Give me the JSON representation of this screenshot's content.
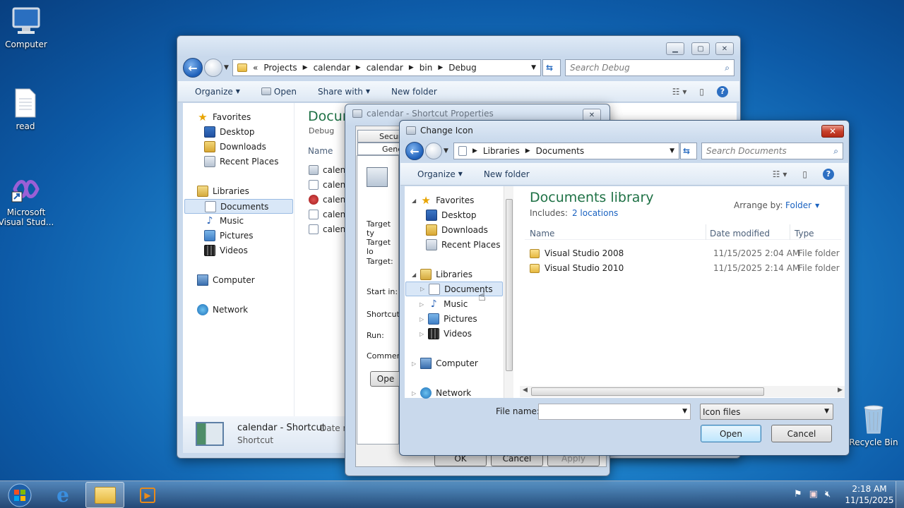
{
  "desktop": {
    "icons": [
      {
        "label": "Computer",
        "icon": "computer-icon"
      },
      {
        "label": "read",
        "icon": "text-file-icon"
      },
      {
        "label": "Microsoft Visual Stud...",
        "icon": "visual-studio-icon"
      },
      {
        "label": "Recycle Bin",
        "icon": "recycle-bin-icon"
      }
    ]
  },
  "explorer": {
    "breadcrumb_prefix": "«",
    "breadcrumb": [
      "Projects",
      "calendar",
      "calendar",
      "bin",
      "Debug"
    ],
    "search_placeholder": "Search Debug",
    "toolbar": {
      "organize": "Organize",
      "open": "Open",
      "share_with": "Share with",
      "new_folder": "New folder"
    },
    "nav": {
      "favorites": "Favorites",
      "desktop": "Desktop",
      "downloads": "Downloads",
      "recent": "Recent Places",
      "libraries": "Libraries",
      "documents": "Documents",
      "music": "Music",
      "pictures": "Pictures",
      "videos": "Videos",
      "computer": "Computer",
      "network": "Network"
    },
    "heading": "Docum",
    "subheading": "Debug",
    "column_name": "Name",
    "files": [
      "calenc",
      "calenc",
      "calenc",
      "calenc",
      "calenc"
    ],
    "details": {
      "name": "calendar - Shortcut",
      "date_label": "Date m",
      "type": "Shortcut"
    }
  },
  "properties": {
    "title": "calendar - Shortcut Properties",
    "tabs": [
      "Securi",
      "Gene"
    ],
    "fields": [
      "Target ty",
      "Target lo",
      "Target:",
      "Start in:",
      "Shortcut",
      "Run:",
      "Commen"
    ],
    "open_button": "Ope",
    "ok": "OK",
    "cancel": "Cancel",
    "apply": "Apply"
  },
  "change_icon": {
    "title": "Change Icon",
    "breadcrumb": [
      "Libraries",
      "Documents"
    ],
    "search_placeholder": "Search Documents",
    "toolbar": {
      "organize": "Organize",
      "new_folder": "New folder"
    },
    "nav": {
      "favorites": "Favorites",
      "desktop": "Desktop",
      "downloads": "Downloads",
      "recent": "Recent Places",
      "libraries": "Libraries",
      "documents": "Documents",
      "music": "Music",
      "pictures": "Pictures",
      "videos": "Videos",
      "computer": "Computer",
      "network": "Network"
    },
    "library_title": "Documents library",
    "includes_label": "Includes:",
    "includes_link": "2 locations",
    "arrange_label": "Arrange by:",
    "arrange_value": "Folder",
    "columns": {
      "name": "Name",
      "date": "Date modified",
      "type": "Type"
    },
    "rows": [
      {
        "name": "Visual Studio 2008",
        "date": "11/15/2025 2:04 AM",
        "type": "File folder"
      },
      {
        "name": "Visual Studio 2010",
        "date": "11/15/2025 2:14 AM",
        "type": "File folder"
      }
    ],
    "file_name_label": "File name:",
    "file_name_value": "",
    "filter": "Icon files",
    "open": "Open",
    "cancel": "Cancel"
  },
  "taskbar": {
    "time": "2:18 AM",
    "date": "11/15/2025"
  }
}
